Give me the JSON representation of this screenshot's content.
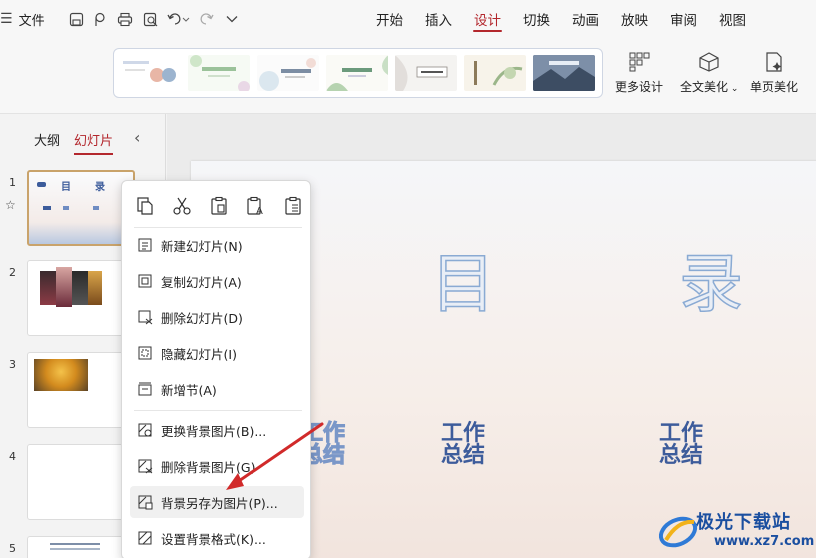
{
  "menubar": {
    "file_label": "文件",
    "tabs": [
      "开始",
      "插入",
      "设计",
      "切换",
      "动画",
      "放映",
      "审阅",
      "视图"
    ],
    "active_tab": "设计"
  },
  "ribbon": {
    "more_design": "更多设计",
    "beautify_all": "全文美化",
    "single_page_beautify": "单页美化"
  },
  "left_panel": {
    "tab_outline": "大纲",
    "tab_slides": "幻灯片",
    "slides": [
      {
        "number": "1",
        "title_chars": [
          "目",
          "录"
        ]
      },
      {
        "number": "2"
      },
      {
        "number": "3"
      },
      {
        "number": "4"
      },
      {
        "number": "5"
      }
    ]
  },
  "slide": {
    "char1": "目",
    "char2": "录",
    "work_line1": "工作",
    "work_line2": "总结"
  },
  "context_menu": {
    "items": [
      "新建幻灯片(N)",
      "复制幻灯片(A)",
      "删除幻灯片(D)",
      "隐藏幻灯片(I)",
      "新增节(A)",
      "更换背景图片(B)...",
      "删除背景图片(G)",
      "背景另存为图片(P)...",
      "设置背景格式(K)..."
    ],
    "highlighted": "背景另存为图片(P)..."
  },
  "watermark": {
    "name": "极光下载站",
    "url": "www.xz7.com"
  },
  "colors": {
    "accent": "#b3272d",
    "arrow": "#d12a2a",
    "slide_text": "#3d5c9b"
  }
}
